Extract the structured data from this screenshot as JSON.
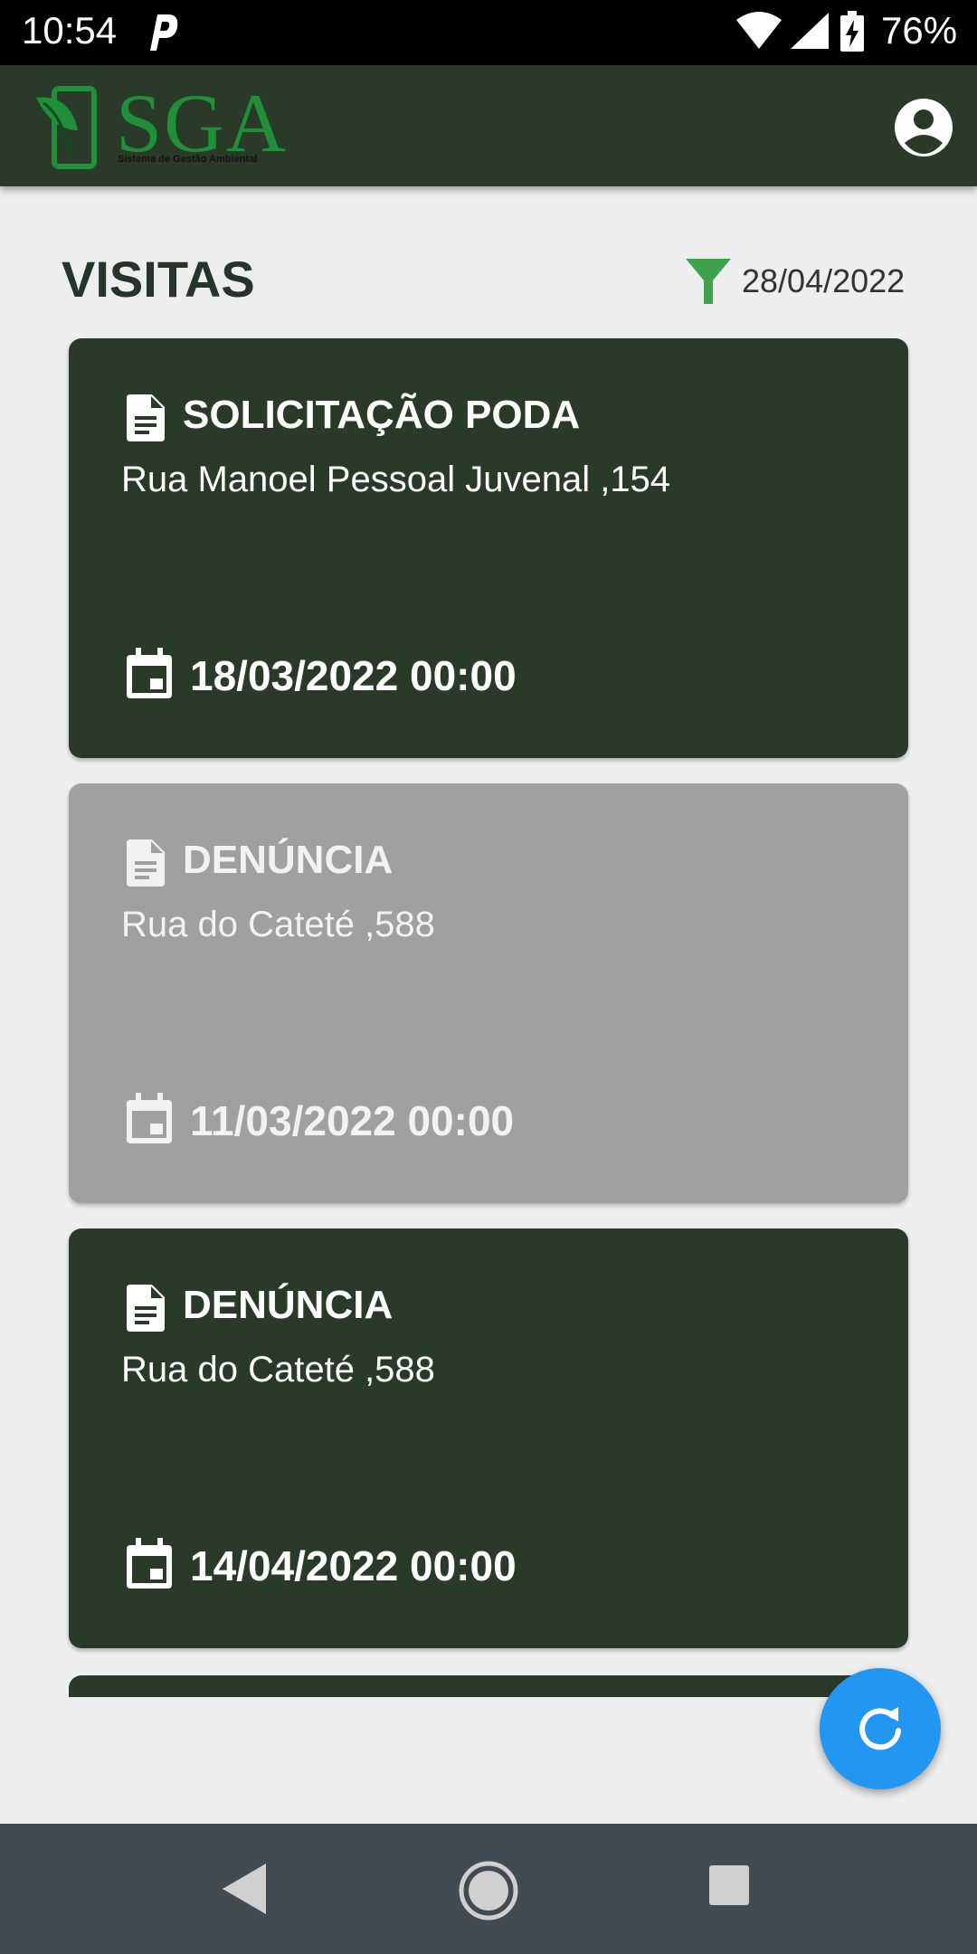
{
  "status_bar": {
    "time": "10:54",
    "battery_percent": "76%"
  },
  "app_bar": {
    "logo": {
      "text": "SGA",
      "subtitle": "Sistema de Gestão Ambiental",
      "color": "#1f8f3a"
    },
    "background": "#2a3a28"
  },
  "page": {
    "title": "VISITAS",
    "filter": {
      "date": "28/04/2022",
      "icon": "filter-icon",
      "icon_color": "#3fa34d"
    }
  },
  "visits": [
    {
      "type": "SOLICITAÇÃO PODA",
      "address": "Rua Manoel Pessoal Juvenal ,154",
      "datetime": "18/03/2022 00:00",
      "style": "dark"
    },
    {
      "type": "DENÚNCIA",
      "address": "Rua do Cateté ,588",
      "datetime": "11/03/2022 00:00",
      "style": "gray"
    },
    {
      "type": "DENÚNCIA",
      "address": "Rua do Cateté ,588",
      "datetime": "14/04/2022 00:00",
      "style": "dark"
    }
  ],
  "fab": {
    "icon": "refresh-icon",
    "color": "#2196f3"
  },
  "colors": {
    "card_dark": "#2a3a28",
    "card_gray": "#a0a0a0",
    "background": "#eeeeee",
    "navbar": "#424a52"
  }
}
